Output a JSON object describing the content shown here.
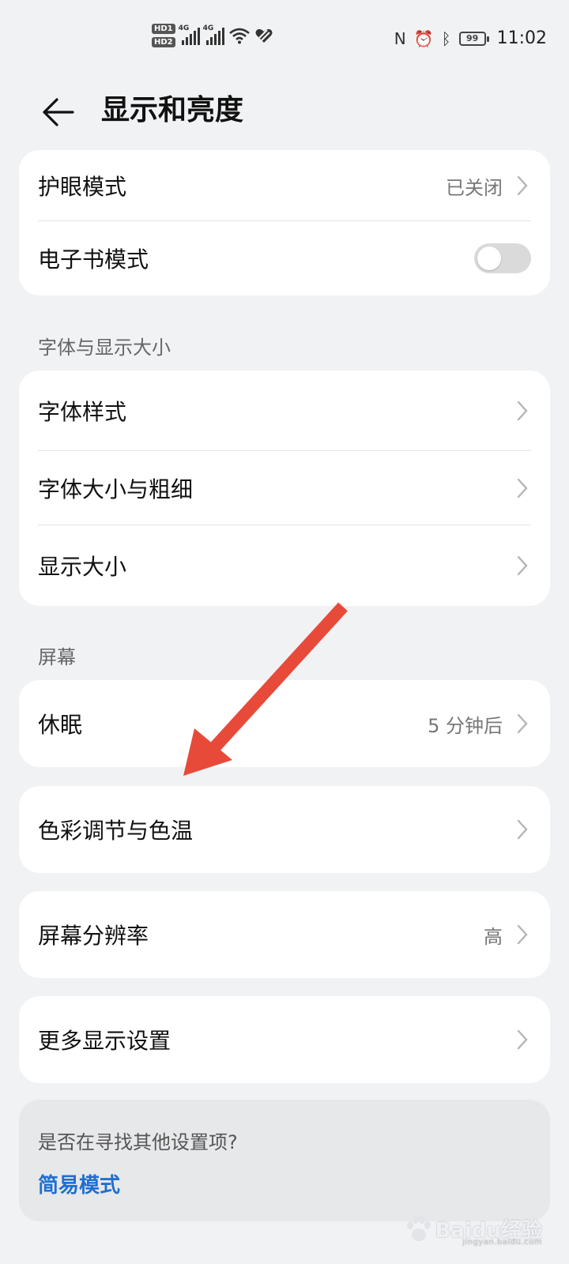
{
  "status_bar": {
    "hd1": "HD1",
    "hd2": "HD2",
    "net1": "4G",
    "net2": "4G",
    "battery": "99",
    "time": "11:02"
  },
  "header": {
    "title": "显示和亮度"
  },
  "eye_card": {
    "eye_mode": {
      "label": "护眼模式",
      "value": "已关闭"
    },
    "ebook_mode": {
      "label": "电子书模式",
      "toggle_on": false
    }
  },
  "font_section": {
    "title": "字体与显示大小",
    "items": [
      {
        "label": "字体样式"
      },
      {
        "label": "字体大小与粗细"
      },
      {
        "label": "显示大小"
      }
    ]
  },
  "screen_section": {
    "title": "屏幕",
    "sleep": {
      "label": "休眠",
      "value": "5 分钟后"
    }
  },
  "color_item": {
    "label": "色彩调节与色温"
  },
  "resolution_item": {
    "label": "屏幕分辨率",
    "value": "高"
  },
  "more_item": {
    "label": "更多显示设置"
  },
  "suggest": {
    "question": "是否在寻找其他设置项?",
    "link": "简易模式"
  },
  "annotation": {
    "arrow_color": "#e84a3a"
  },
  "watermark": {
    "text": "Baidu经验",
    "sub": "jingyan.baidu.com"
  }
}
